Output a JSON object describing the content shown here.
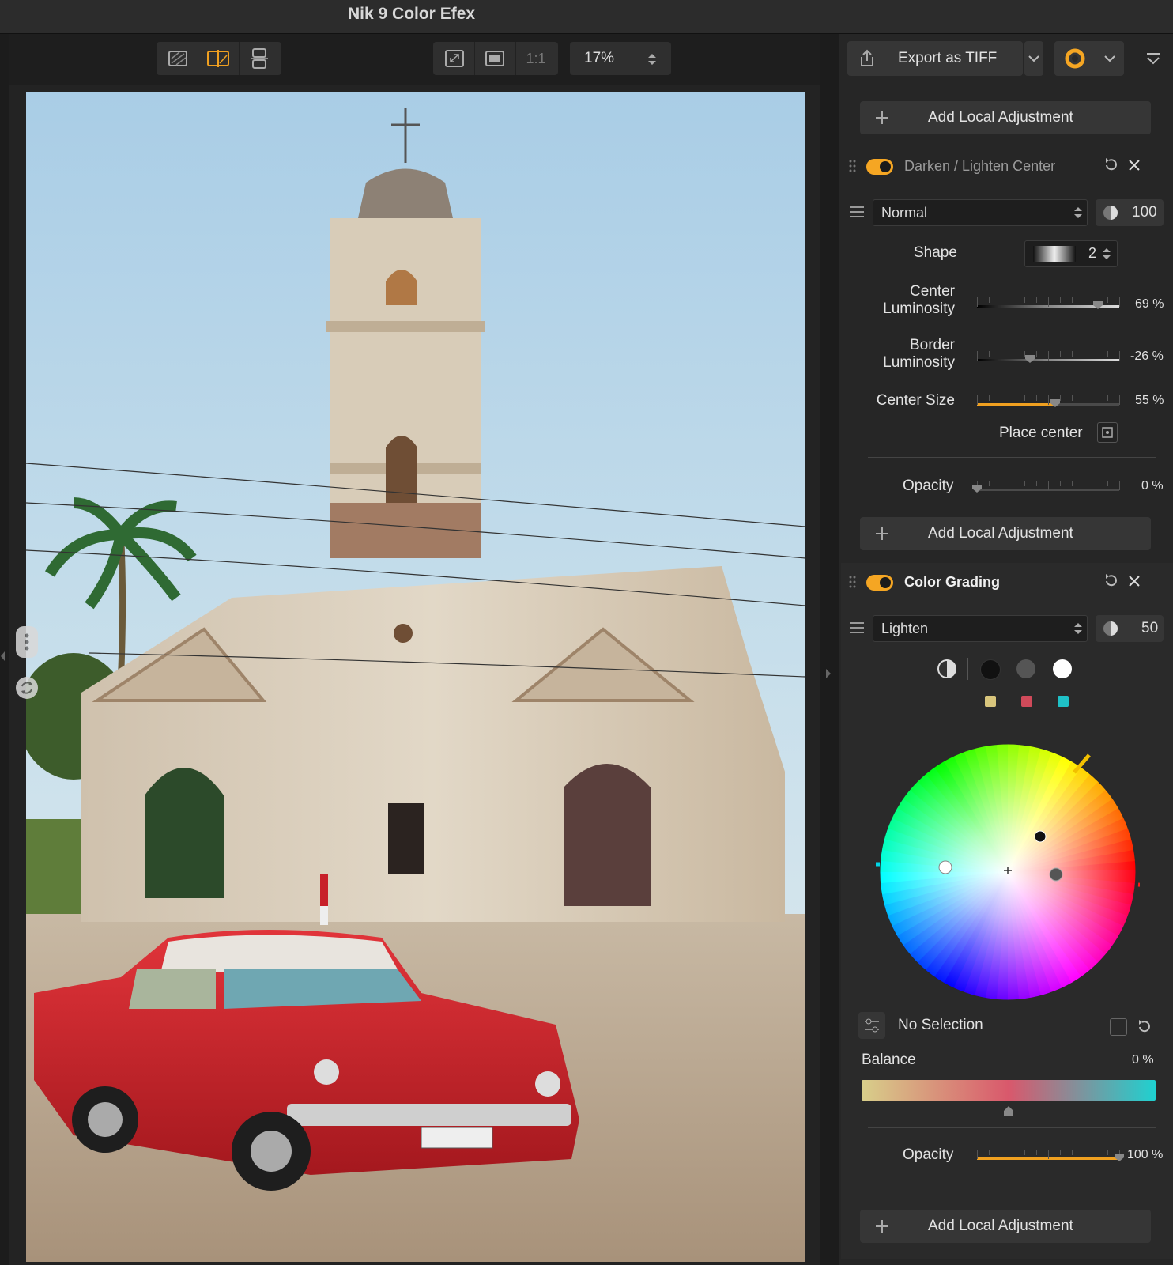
{
  "app": {
    "title": "Nik 9 Color Efex"
  },
  "toolbar": {
    "view_modes": [
      "single-view-icon",
      "split-view-icon",
      "side-by-side-icon"
    ],
    "fit_icon": "fit-screen-icon",
    "fill_icon": "fill-screen-icon",
    "zoom_100": "1:1",
    "zoom_value": "17%"
  },
  "export": {
    "label": "Export as TIFF"
  },
  "panel": {
    "add_local_adjustment": "Add Local Adjustment",
    "filter1": {
      "name": "Darken / Lighten Center",
      "enabled": true,
      "blend_mode": "Normal",
      "blend_opacity": "100",
      "shape_label": "Shape",
      "shape_value": "2",
      "center_lum_label_1": "Center",
      "center_lum_label_2": "Luminosity",
      "center_lum_value": "69 %",
      "center_lum_pct": 0.85,
      "border_lum_label_1": "Border",
      "border_lum_label_2": "Luminosity",
      "border_lum_value": "-26 %",
      "border_lum_pct": 0.37,
      "center_size_label": "Center Size",
      "center_size_value": "55 %",
      "center_size_pct": 0.55,
      "place_center_label": "Place center",
      "opacity_label": "Opacity",
      "opacity_value": "0 %",
      "opacity_pct": 0.0
    },
    "filter2": {
      "name": "Color Grading",
      "enabled": true,
      "blend_mode": "Lighten",
      "blend_opacity": "50",
      "selection_label": "No Selection",
      "balance_label": "Balance",
      "balance_value": "0 %",
      "balance_pct": 0.5,
      "opacity_label": "Opacity",
      "opacity_value": "100 %",
      "opacity_pct": 1.0,
      "tone_swatches": [
        "#111111",
        "#555555",
        "#ffffff"
      ],
      "color_swatches": [
        "#d8c57c",
        "#d04a5a",
        "#1fc1c7"
      ],
      "balance_gradient": [
        "#d8cf8a",
        "#d9586c",
        "#1fd1d0"
      ]
    }
  }
}
